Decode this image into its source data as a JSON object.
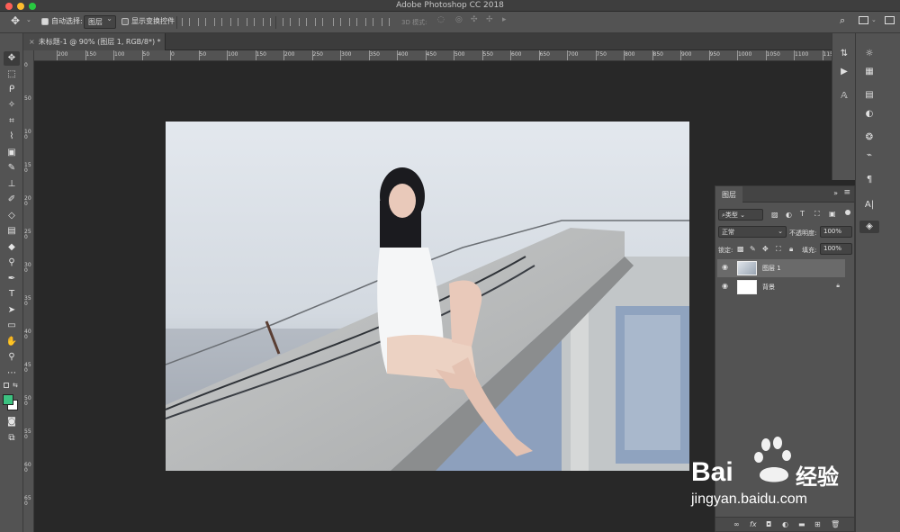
{
  "app": {
    "title": "Adobe Photoshop CC 2018"
  },
  "options_bar": {
    "auto_select_label": "自动选择:",
    "auto_select_value": "图层",
    "show_transform_label": "显示变换控件",
    "mode_3d_label": "3D 模式:"
  },
  "document": {
    "tab_title": "未标题-1 @ 90% (图层 1, RGB/8*) *"
  },
  "ruler": {
    "top_ticks": [
      "200",
      "150",
      "100",
      "50",
      "0",
      "50",
      "100",
      "150",
      "200",
      "250",
      "300",
      "350",
      "400",
      "450",
      "500",
      "550",
      "600",
      "650",
      "700",
      "750",
      "800",
      "850",
      "900",
      "950",
      "1000",
      "1050",
      "1100",
      "1150"
    ],
    "left_ticks": [
      "0",
      "50",
      "100",
      "150",
      "200",
      "250",
      "300",
      "350",
      "400",
      "450",
      "500",
      "550",
      "600",
      "650"
    ]
  },
  "layers_panel": {
    "title": "图层",
    "filter_kind": "类型",
    "blend_mode": "正常",
    "opacity_label": "不透明度:",
    "opacity_value": "100%",
    "lock_label": "锁定:",
    "fill_label": "填充:",
    "fill_value": "100%",
    "layers": [
      {
        "name": "图层 1",
        "selected": true
      },
      {
        "name": "背景",
        "selected": false,
        "locked": true
      }
    ]
  },
  "colors": {
    "foreground": "#3cc280",
    "background": "#ffffff",
    "ui_panel": "#535353",
    "canvas_bg": "#282828"
  },
  "watermark": {
    "brand": "Bai",
    "brand_suffix": "经验",
    "url": "jingyan.baidu.com"
  }
}
